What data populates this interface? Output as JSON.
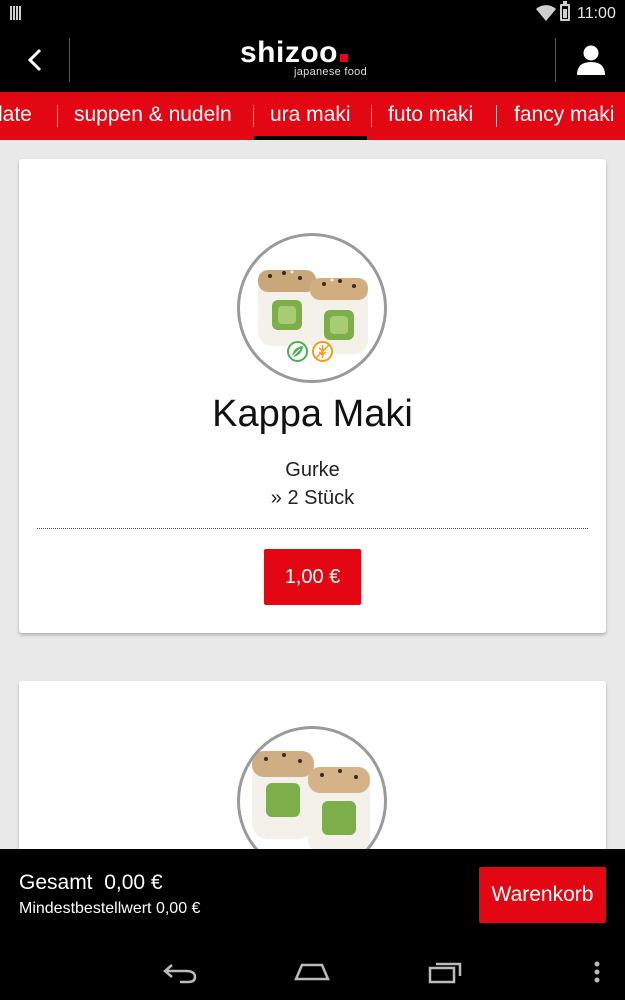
{
  "status_bar": {
    "time": "11:00"
  },
  "header": {
    "logo_name": "shizoo",
    "logo_tagline": "japanese food",
    "back_icon": "chevron-left-icon",
    "user_icon": "user-icon"
  },
  "tabs": [
    {
      "label": "late",
      "active": false
    },
    {
      "label": "suppen & nudeln",
      "active": false
    },
    {
      "label": "ura maki",
      "active": true
    },
    {
      "label": "futo maki",
      "active": false
    },
    {
      "label": "fancy maki",
      "active": false
    }
  ],
  "products": [
    {
      "title": "Kappa Maki",
      "description": "Gurke",
      "quantity": "» 2 Stück",
      "price": "1,00 €",
      "badges": [
        "vegetarian-icon",
        "no-gluten-icon"
      ]
    }
  ],
  "cart": {
    "total": "Gesamt  0,00 €",
    "minimum": "Mindestbestellwert 0,00 €",
    "button_label": "Warenkorb"
  },
  "colors": {
    "brand_red": "#e30613",
    "background": "#e9e9e9",
    "bar": "#000000"
  }
}
